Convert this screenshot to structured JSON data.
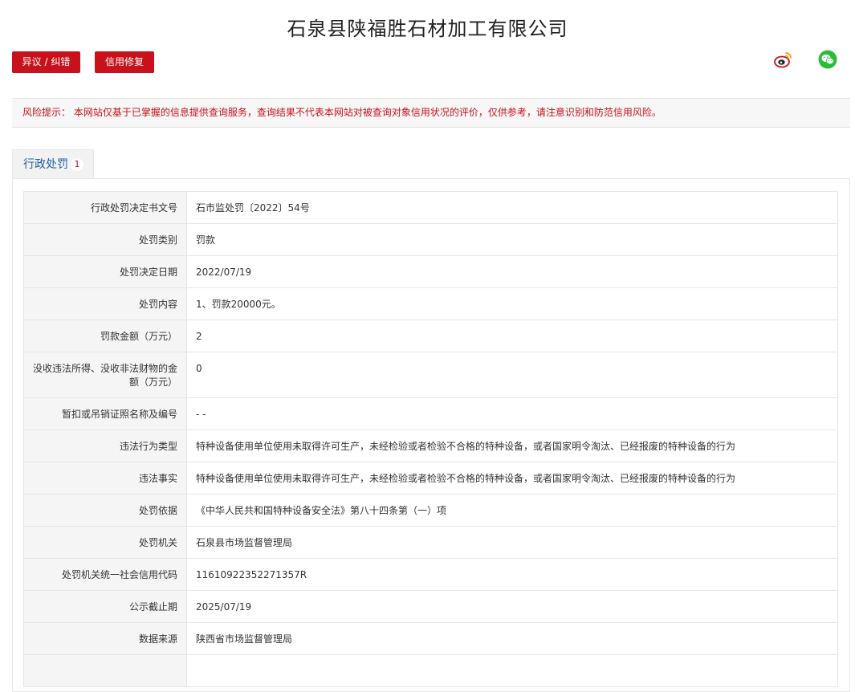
{
  "company_name": "石泉县陕福胜石材加工有限公司",
  "buttons": {
    "objection": "异议 / 纠错",
    "credit_repair": "信用修复"
  },
  "icons": {
    "weibo": "weibo-icon",
    "wechat": "wechat-icon"
  },
  "colors": {
    "accent_red": "#c8111a",
    "tab_blue": "#1f5fa8",
    "wechat_green": "#2dbb3c"
  },
  "risk_notice": "风险提示： 本网站仅基于已掌握的信息提供查询服务，查询结果不代表本网站对被查询对象信用状况的评价，仅供参考，请注意识别和防范信用风险。",
  "tab": {
    "label": "行政处罚",
    "count": "1"
  },
  "rows": [
    {
      "key": "行政处罚决定书文号",
      "value": "石市监处罚〔2022〕54号"
    },
    {
      "key": "处罚类别",
      "value": "罚款"
    },
    {
      "key": "处罚决定日期",
      "value": "2022/07/19"
    },
    {
      "key": "处罚内容",
      "value": "1、罚款20000元。"
    },
    {
      "key": "罚款金额（万元）",
      "value": "2"
    },
    {
      "key": "没收违法所得、没收非法财物的金额（万元）",
      "value": "0"
    },
    {
      "key": "暂扣或吊销证照名称及编号",
      "value": "- -"
    },
    {
      "key": "违法行为类型",
      "value": "特种设备使用单位使用未取得许可生产，未经检验或者检验不合格的特种设备，或者国家明令淘汰、已经报废的特种设备的行为"
    },
    {
      "key": "违法事实",
      "value": "特种设备使用单位使用未取得许可生产，未经检验或者检验不合格的特种设备，或者国家明令淘汰、已经报废的特种设备的行为"
    },
    {
      "key": "处罚依据",
      "value": "《中华人民共和国特种设备安全法》第八十四条第（一）项"
    },
    {
      "key": "处罚机关",
      "value": "石泉县市场监督管理局"
    },
    {
      "key": "处罚机关统一社会信用代码",
      "value": "11610922352271357R"
    },
    {
      "key": "公示截止期",
      "value": "2025/07/19"
    },
    {
      "key": "数据来源",
      "value": "陕西省市场监督管理局"
    },
    {
      "key": "",
      "value": ""
    }
  ]
}
